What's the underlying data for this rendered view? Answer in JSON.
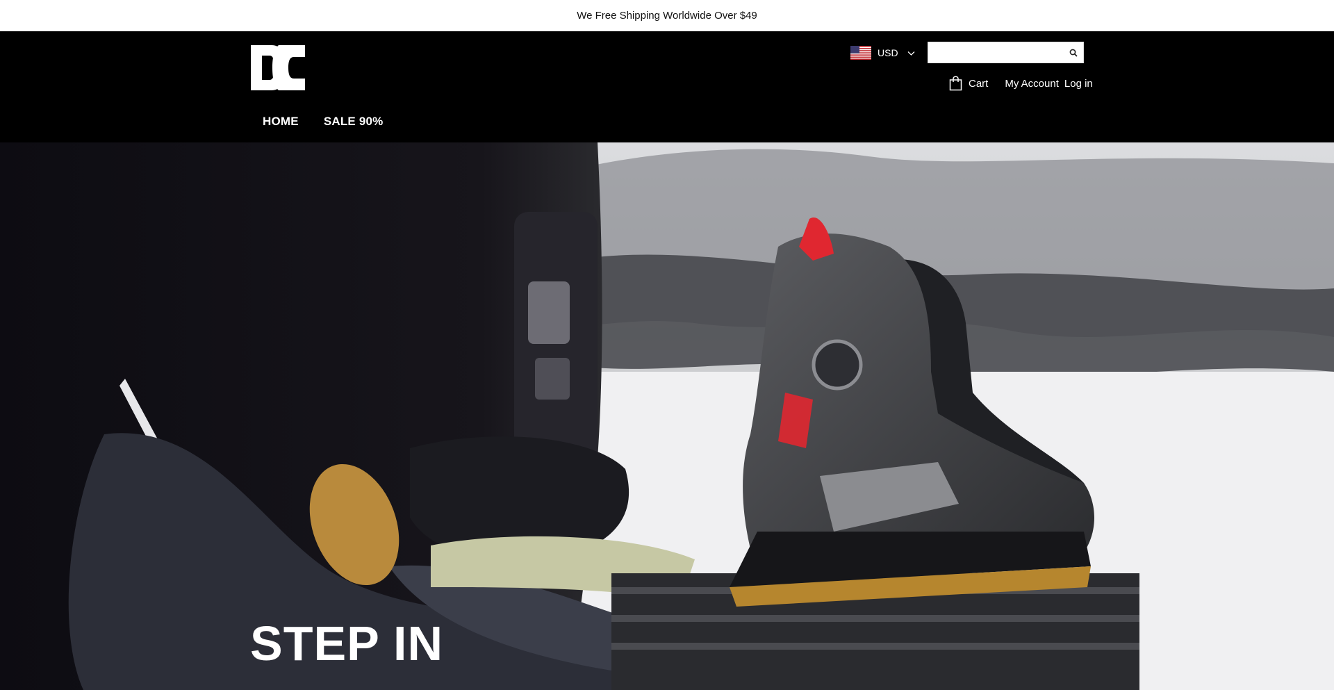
{
  "announcement": "We Free Shipping Worldwide Over $49",
  "header": {
    "currency": "USD",
    "search": {
      "placeholder": "",
      "value": ""
    },
    "cart_label": "Cart",
    "account_label": "My Account",
    "login_label": "Log in"
  },
  "nav": {
    "items": [
      "HOME",
      "SALE 90%"
    ]
  },
  "hero": {
    "title": "STEP IN"
  },
  "icons": {
    "logo": "dc-shoes-logo",
    "flag": "us-flag-icon",
    "currency_toggle": "chevron-down-icon",
    "search": "search-icon",
    "cart": "shopping-bag-icon"
  },
  "colors": {
    "header_bg": "#000000",
    "announcement_bg": "#ffffff",
    "accent_red": "#e02730"
  }
}
